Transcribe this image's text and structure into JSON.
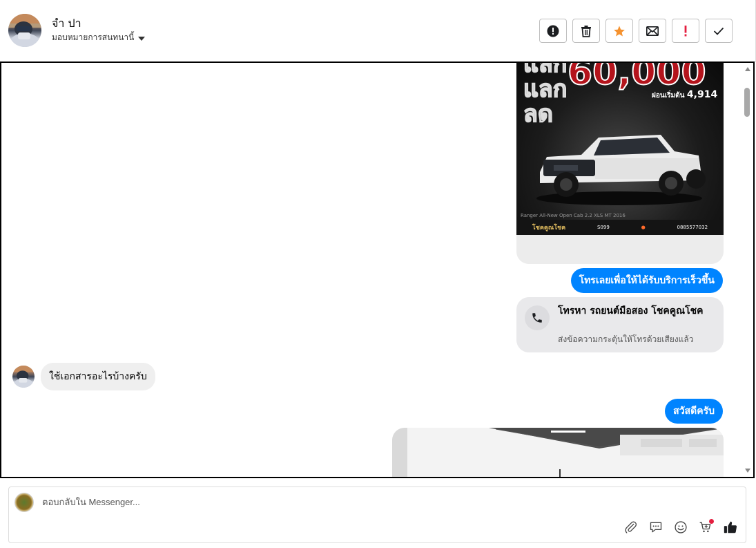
{
  "header": {
    "contact_name": "จำ ปา",
    "assign_label": "มอบหมายการสนทนานี้"
  },
  "actions": [
    {
      "name": "spam-button",
      "icon": "alert-circle-icon"
    },
    {
      "name": "delete-button",
      "icon": "trash-icon"
    },
    {
      "name": "star-button",
      "icon": "star-icon"
    },
    {
      "name": "mark-unread-button",
      "icon": "envelope-icon"
    },
    {
      "name": "important-button",
      "icon": "exclamation-icon"
    },
    {
      "name": "done-button",
      "icon": "check-icon"
    }
  ],
  "messages": {
    "ad": {
      "big_text": "แลก\nลด",
      "price": "60,000",
      "installment_label": "ผ่อนเริ่มต้น",
      "installment_value": "4,914",
      "model": "Ranger All-New Open Cab 2.2 XLS MT 2016",
      "brand": "โชคคูณโชค",
      "code": "S099",
      "phone": "0885577032"
    },
    "out_call_prompt": "โทรเลยเพื่อให้ได้รับบริการเร็วขึ้น",
    "call_card": {
      "title": "โทรหา รถยนต์มือสอง โชคคูณโชค",
      "subtitle": "ส่งข้อความกระตุ้นให้โทรด้วยเสียงแล้ว"
    },
    "in_question": "ใช้เอกสารอะไรบ้างครับ",
    "out_greeting": "สวัสดีครับ"
  },
  "composer": {
    "placeholder": "ตอบกลับใน Messenger..."
  },
  "colors": {
    "messenger_blue": "#0084ff",
    "star_orange": "#f5922f",
    "important_red": "#e41e3f"
  }
}
